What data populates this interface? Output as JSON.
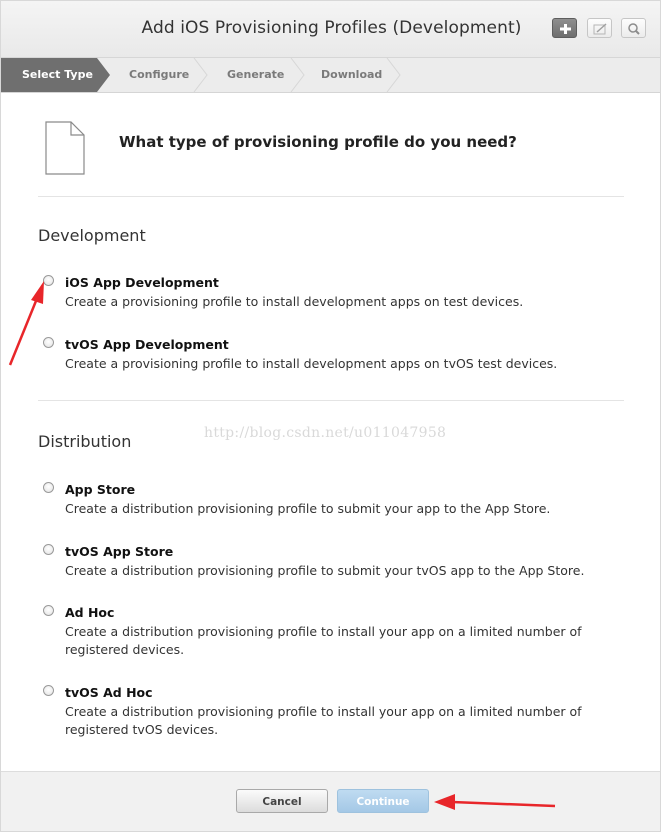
{
  "window": {
    "title": "Add iOS Provisioning Profiles (Development)",
    "toolbar_buttons": [
      {
        "name": "add",
        "icon": "plus-icon"
      },
      {
        "name": "edit",
        "icon": "edit-icon"
      },
      {
        "name": "search",
        "icon": "search-icon"
      }
    ]
  },
  "steps": [
    {
      "label": "Select Type",
      "active": true
    },
    {
      "label": "Configure",
      "active": false
    },
    {
      "label": "Generate",
      "active": false
    },
    {
      "label": "Download",
      "active": false
    }
  ],
  "header": {
    "icon": "document-icon",
    "question": "What type of provisioning profile do you need?"
  },
  "development": {
    "title": "Development",
    "options": [
      {
        "title": "iOS App Development",
        "desc": "Create a provisioning profile to install development apps on test devices."
      },
      {
        "title": "tvOS App Development",
        "desc": "Create a provisioning profile to install development apps on tvOS test devices."
      }
    ]
  },
  "distribution": {
    "title": "Distribution",
    "options": [
      {
        "title": "App Store",
        "desc": "Create a distribution provisioning profile to submit your app to the App Store."
      },
      {
        "title": "tvOS App Store",
        "desc": "Create a distribution provisioning profile to submit your tvOS app to the App Store."
      },
      {
        "title": "Ad Hoc",
        "desc": "Create a distribution provisioning profile to install your app on a limited number of registered devices."
      },
      {
        "title": "tvOS Ad Hoc",
        "desc": "Create a distribution provisioning profile to install your app on a limited number of registered tvOS devices."
      }
    ]
  },
  "watermark": "http://blog.csdn.net/u011047958",
  "footer": {
    "cancel_label": "Cancel",
    "continue_label": "Continue"
  },
  "colors": {
    "active_step_bg": "#6f6f6f",
    "continue_bg": "#b3d3ec",
    "annotation_arrow": "#e8262a"
  }
}
